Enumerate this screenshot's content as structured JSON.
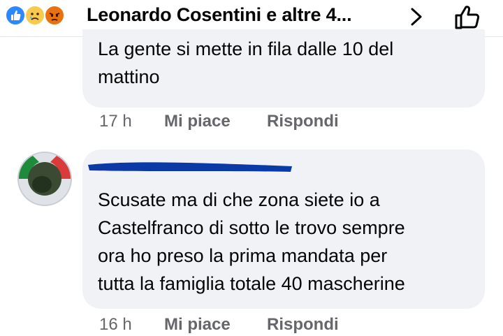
{
  "header": {
    "reactions": [
      "like-icon",
      "sad-icon",
      "angry-icon"
    ],
    "title": "Leonardo Cosentini e altre 4..."
  },
  "comments": [
    {
      "text_lines": [
        "La gente si mette in fila dalle 10 del",
        "mattino"
      ],
      "time": "17 h",
      "like_label": "Mi piace",
      "reply_label": "Rispondi"
    },
    {
      "author": "",
      "text_lines": [
        "Scusate ma di che zona siete io a",
        "Castelfranco di sotto le trovo sempre",
        "ora ho preso la prima mandata per",
        "tutta la famiglia totale 40 mascherine"
      ],
      "time": "16 h",
      "like_label": "Mi piace",
      "reply_label": "Rispondi"
    }
  ],
  "colors": {
    "bubble": "#f0f2f5",
    "meta_text": "#65676b",
    "like_blue": "#2d88ff"
  }
}
